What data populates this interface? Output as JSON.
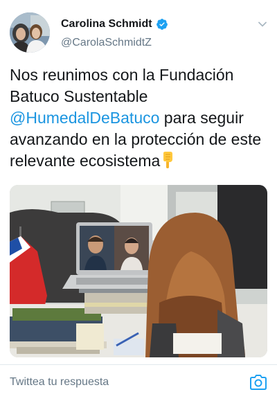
{
  "tweet": {
    "author": {
      "display_name": "Carolina Schmidt",
      "handle": "@CarolaSchmidtZ",
      "verified": true
    },
    "text": {
      "part1": "Nos reunimos con la Fundación Batuco Sustentable ",
      "mention": "@HumedalDeBatuco",
      "part2": " para seguir avanzando en la protección de este relevante ecosistema",
      "emoji": "backhand-index-pointing-down"
    },
    "media": {
      "type": "photo"
    }
  },
  "reply": {
    "placeholder": "Twittea tu respuesta"
  },
  "icons": {
    "verified": "verified-badge-icon",
    "menu": "chevron-down-icon",
    "camera": "camera-icon"
  },
  "colors": {
    "link": "#1b95e0",
    "verified": "#1da1f2",
    "secondary_text": "#657786"
  }
}
